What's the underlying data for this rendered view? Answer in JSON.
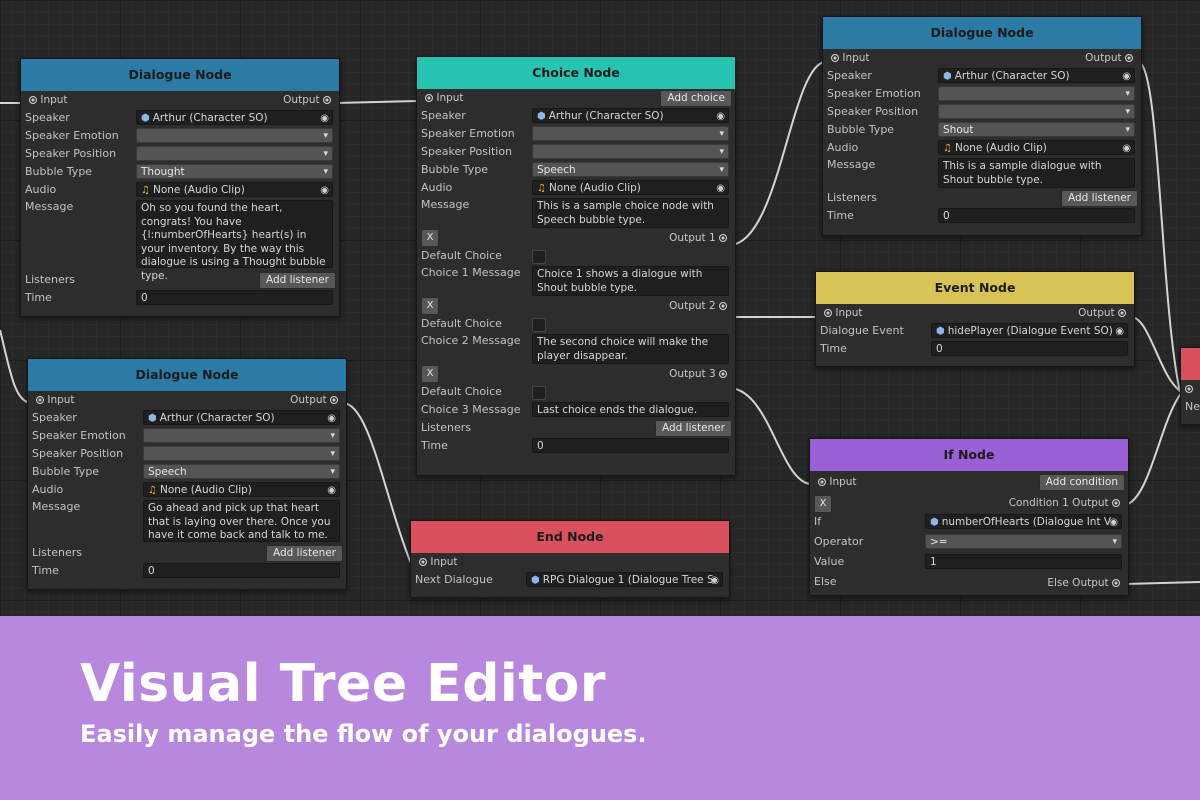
{
  "banner": {
    "title": "Visual Tree Editor",
    "subtitle": "Easily manage the flow of your dialogues."
  },
  "colors": {
    "dialogue_header": "#2c7ba6",
    "choice_header": "#27c3b2",
    "end_header": "#d9515d",
    "event_header": "#d8c355",
    "if_header": "#9b5fd6",
    "banner_bg": "#b888de"
  },
  "labels": {
    "input": "Input",
    "output": "Output",
    "speaker": "Speaker",
    "speaker_emotion": "Speaker Emotion",
    "speaker_position": "Speaker Position",
    "bubble_type": "Bubble Type",
    "audio": "Audio",
    "message": "Message",
    "listeners": "Listeners",
    "time": "Time",
    "add_listener": "Add listener",
    "add_choice": "Add choice",
    "add_condition": "Add condition",
    "default_choice": "Default Choice",
    "x": "X",
    "next_dialogue": "Next Dialogue",
    "dialogue_event": "Dialogue Event",
    "if": "If",
    "operator": "Operator",
    "value": "Value",
    "else": "Else",
    "else_output": "Else Output",
    "partial_label": "Ne"
  },
  "nodes": {
    "dialogue1": {
      "title": "Dialogue Node",
      "speaker": "Arthur (Character SO)",
      "bubble_type": "Thought",
      "audio": "None (Audio Clip)",
      "message": "Oh so you found the heart, congrats! You have {l:numberOfHearts} heart(s) in your inventory. By the way this dialogue is using a Thought bubble type.",
      "time": "0"
    },
    "dialogue2": {
      "title": "Dialogue Node",
      "speaker": "Arthur (Character SO)",
      "bubble_type": "Speech",
      "audio": "None (Audio Clip)",
      "message": "Go ahead and pick up that heart that is laying over there. Once you have it come back and talk to me.",
      "time": "0"
    },
    "choice": {
      "title": "Choice Node",
      "speaker": "Arthur (Character SO)",
      "bubble_type": "Speech",
      "audio": "None (Audio Clip)",
      "message": "This is a sample choice node with Speech bubble type.",
      "output1": "Output 1",
      "output2": "Output 2",
      "output3": "Output 3",
      "choice1_label": "Choice 1 Message",
      "choice2_label": "Choice 2 Message",
      "choice3_label": "Choice 3 Message",
      "choice1_msg": "Choice 1 shows a dialogue with Shout bubble type.",
      "choice2_msg": "The second choice will make the player disappear.",
      "choice3_msg": "Last choice ends the dialogue.",
      "time": "0"
    },
    "end": {
      "title": "End Node",
      "next_dialogue": "RPG Dialogue 1 (Dialogue Tree S"
    },
    "dialogue3": {
      "title": "Dialogue Node",
      "speaker": "Arthur (Character SO)",
      "bubble_type": "Shout",
      "audio": "None (Audio Clip)",
      "message": "This is a sample dialogue with Shout bubble type.",
      "time": "0"
    },
    "event": {
      "title": "Event Node",
      "dialogue_event": "hidePlayer (Dialogue Event SO)",
      "time": "0"
    },
    "if": {
      "title": "If Node",
      "condition_output": "Condition 1 Output",
      "if_value": "numberOfHearts (Dialogue Int V",
      "operator": ">=",
      "value": "1"
    }
  }
}
